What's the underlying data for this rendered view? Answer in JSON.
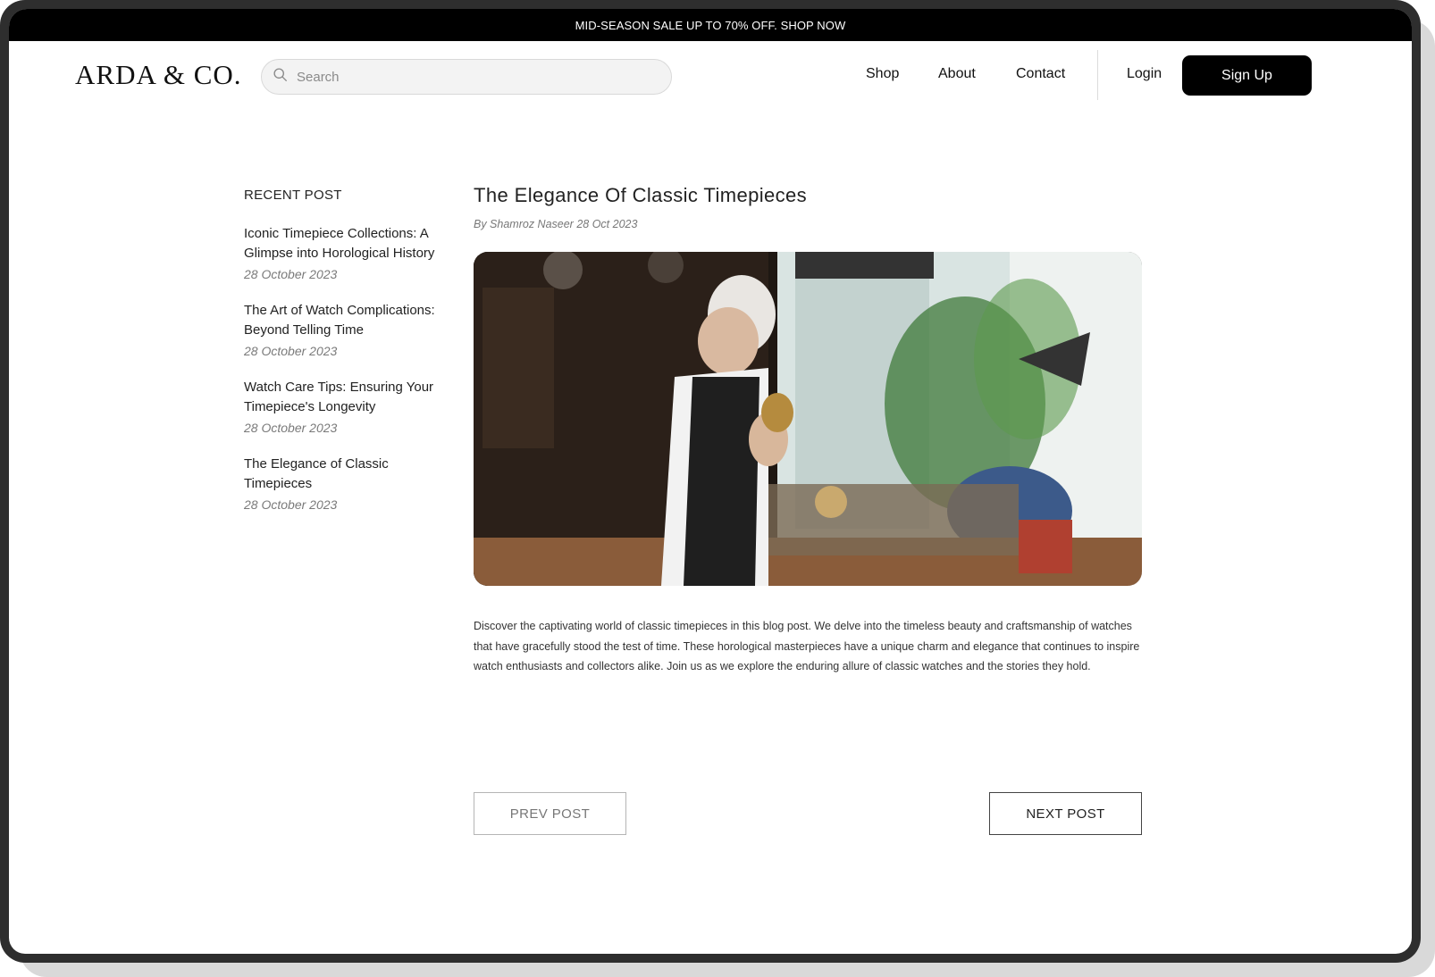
{
  "promo": {
    "text": "MID-SEASON SALE UP TO 70% OFF.  SHOP NOW"
  },
  "header": {
    "logo": "ARDA & CO.",
    "search_placeholder": "Search",
    "nav": [
      "Shop",
      "About",
      "Contact"
    ],
    "login": "Login",
    "signup": "Sign Up"
  },
  "sidebar": {
    "heading": "RECENT POST",
    "posts": [
      {
        "title": "Iconic Timepiece Collections: A Glimpse into Horological History",
        "date": "28 October 2023"
      },
      {
        "title": "The Art of Watch Complications: Beyond Telling Time",
        "date": "28 October 2023"
      },
      {
        "title": "Watch Care Tips: Ensuring Your Timepiece's Longevity",
        "date": "28 October 2023"
      },
      {
        "title": "The Elegance of Classic Timepieces",
        "date": "28 October 2023"
      }
    ]
  },
  "article": {
    "title": "The Elegance Of Classic Timepieces",
    "byline": "By Shamroz Naseer 28 Oct 2023",
    "body": "Discover the captivating world of classic timepieces in this blog post. We delve into the timeless beauty and craftsmanship of watches that have gracefully stood the test of time. These horological masterpieces have a unique charm and elegance that continues to inspire watch enthusiasts and collectors alike. Join us as we explore the enduring allure of classic watches and the stories they hold."
  },
  "pagination": {
    "prev": "PREV POST",
    "next": "NEXT POST"
  }
}
